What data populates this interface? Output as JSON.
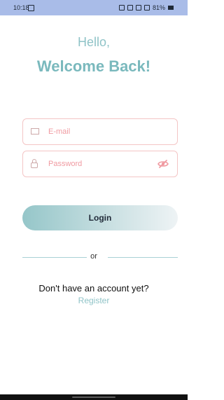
{
  "status_bar": {
    "time": "10:18",
    "battery": "81%"
  },
  "greeting": {
    "hello": "Hello,",
    "welcome": "Welcome Back!"
  },
  "form": {
    "email_placeholder": "E-mail",
    "password_placeholder": "Password",
    "login_label": "Login"
  },
  "divider": {
    "label": "or"
  },
  "footer": {
    "register_prompt": "Don't have an account yet?",
    "register_link": "Register"
  },
  "colors": {
    "status_bar_bg": "#a9bce8",
    "accent": "#8fc3c7",
    "field_border": "#f4c5c5",
    "placeholder": "#f09aa1"
  },
  "icons": {
    "email": "mail-icon",
    "password": "lock-icon",
    "password_toggle": "eye-slash-icon"
  }
}
